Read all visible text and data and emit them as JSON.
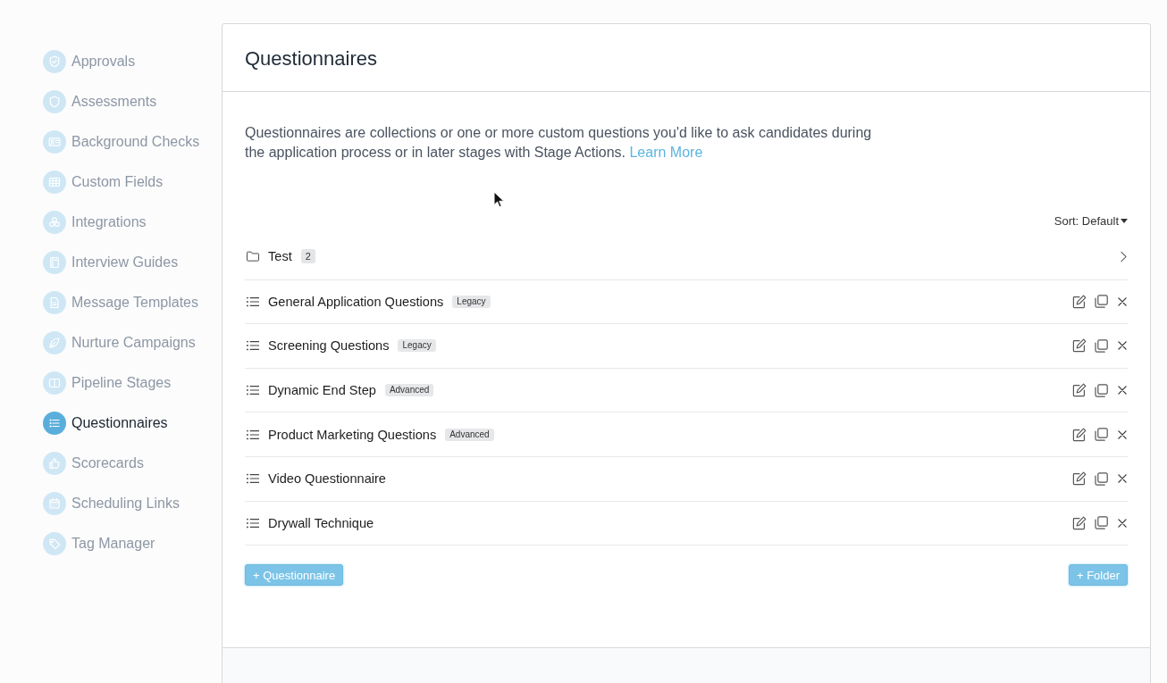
{
  "sidebar": {
    "items": [
      {
        "label": "Approvals",
        "selected": false
      },
      {
        "label": "Assessments",
        "selected": false
      },
      {
        "label": "Background Checks",
        "selected": false
      },
      {
        "label": "Custom Fields",
        "selected": false
      },
      {
        "label": "Integrations",
        "selected": false
      },
      {
        "label": "Interview Guides",
        "selected": false
      },
      {
        "label": "Message Templates",
        "selected": false
      },
      {
        "label": "Nurture Campaigns",
        "selected": false
      },
      {
        "label": "Pipeline Stages",
        "selected": false
      },
      {
        "label": "Questionnaires",
        "selected": true
      },
      {
        "label": "Scorecards",
        "selected": false
      },
      {
        "label": "Scheduling Links",
        "selected": false
      },
      {
        "label": "Tag Manager",
        "selected": false
      }
    ]
  },
  "panel": {
    "title": "Questionnaires",
    "description": "Questionnaires are collections or one or more custom questions you'd like to ask candidates during the application process or in later stages with Stage Actions.",
    "learn_more_link": "Learn More",
    "sort": "Sort: Default",
    "rows": [
      {
        "kind": "folder",
        "name": "Test",
        "count": "2"
      },
      {
        "kind": "questionnaire",
        "name": "General Application Questions",
        "tag": "Legacy"
      },
      {
        "kind": "questionnaire",
        "name": "Screening Questions",
        "tag": "Legacy"
      },
      {
        "kind": "questionnaire",
        "name": "Dynamic End Step",
        "tag": "Advanced"
      },
      {
        "kind": "questionnaire",
        "name": "Product Marketing Questions",
        "tag": "Advanced"
      },
      {
        "kind": "questionnaire",
        "name": "Video Questionnaire"
      },
      {
        "kind": "questionnaire",
        "name": "Drywall Technique"
      }
    ],
    "buttons": [
      {
        "label": "+ Questionnaire"
      },
      {
        "label": "+ Folder"
      }
    ]
  }
}
